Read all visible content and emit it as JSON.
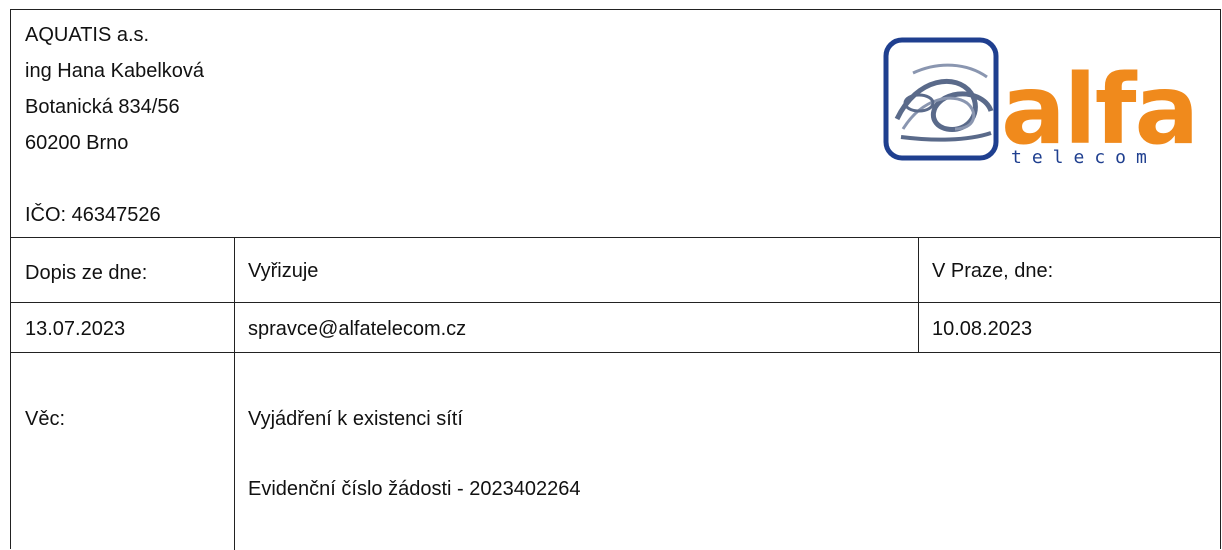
{
  "sender": {
    "company": "AQUATIS a.s.",
    "person": "ing Hana Kabelková",
    "street": "Botanická 834/56",
    "city": "60200 Brno",
    "ico": "IČO: 46347526"
  },
  "logo": {
    "word": "alfa",
    "subword": "telecom",
    "colors": {
      "frame": "#1f3f8f",
      "wave": "#5a6a8a",
      "orange": "#f08a1c",
      "blue": "#1f3f8f"
    }
  },
  "table": {
    "headers": {
      "letter_date_label": "Dopis ze dne:",
      "handled_by_label": "Vyřizuje",
      "place_date_label": "V Praze, dne:"
    },
    "values": {
      "letter_date": "13.07.2023",
      "handled_by": "spravce@alfatelecom.cz",
      "place_date": "10.08.2023"
    },
    "subject": {
      "label": "Věc:",
      "line1": "Vyjádření k existenci sítí",
      "line2": "Evidenční číslo žádosti - 2023402264"
    }
  }
}
